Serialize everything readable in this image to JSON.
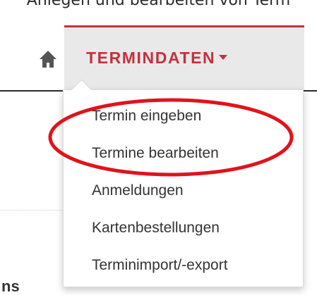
{
  "caption": "Anlegen und bearbeiten von Term",
  "nav": {
    "tab_label": "TERMINDATEN",
    "home_icon": "home-icon",
    "accent_color": "#c5303c"
  },
  "dropdown": {
    "items": [
      {
        "label": "Termin eingeben"
      },
      {
        "label": "Termine bearbeiten"
      },
      {
        "label": "Anmeldungen"
      },
      {
        "label": "Kartenbestellungen"
      },
      {
        "label": "Terminimport/-export"
      }
    ]
  },
  "annotation": {
    "shape": "ellipse",
    "color": "#e0131c"
  },
  "left_fragment": "ns"
}
